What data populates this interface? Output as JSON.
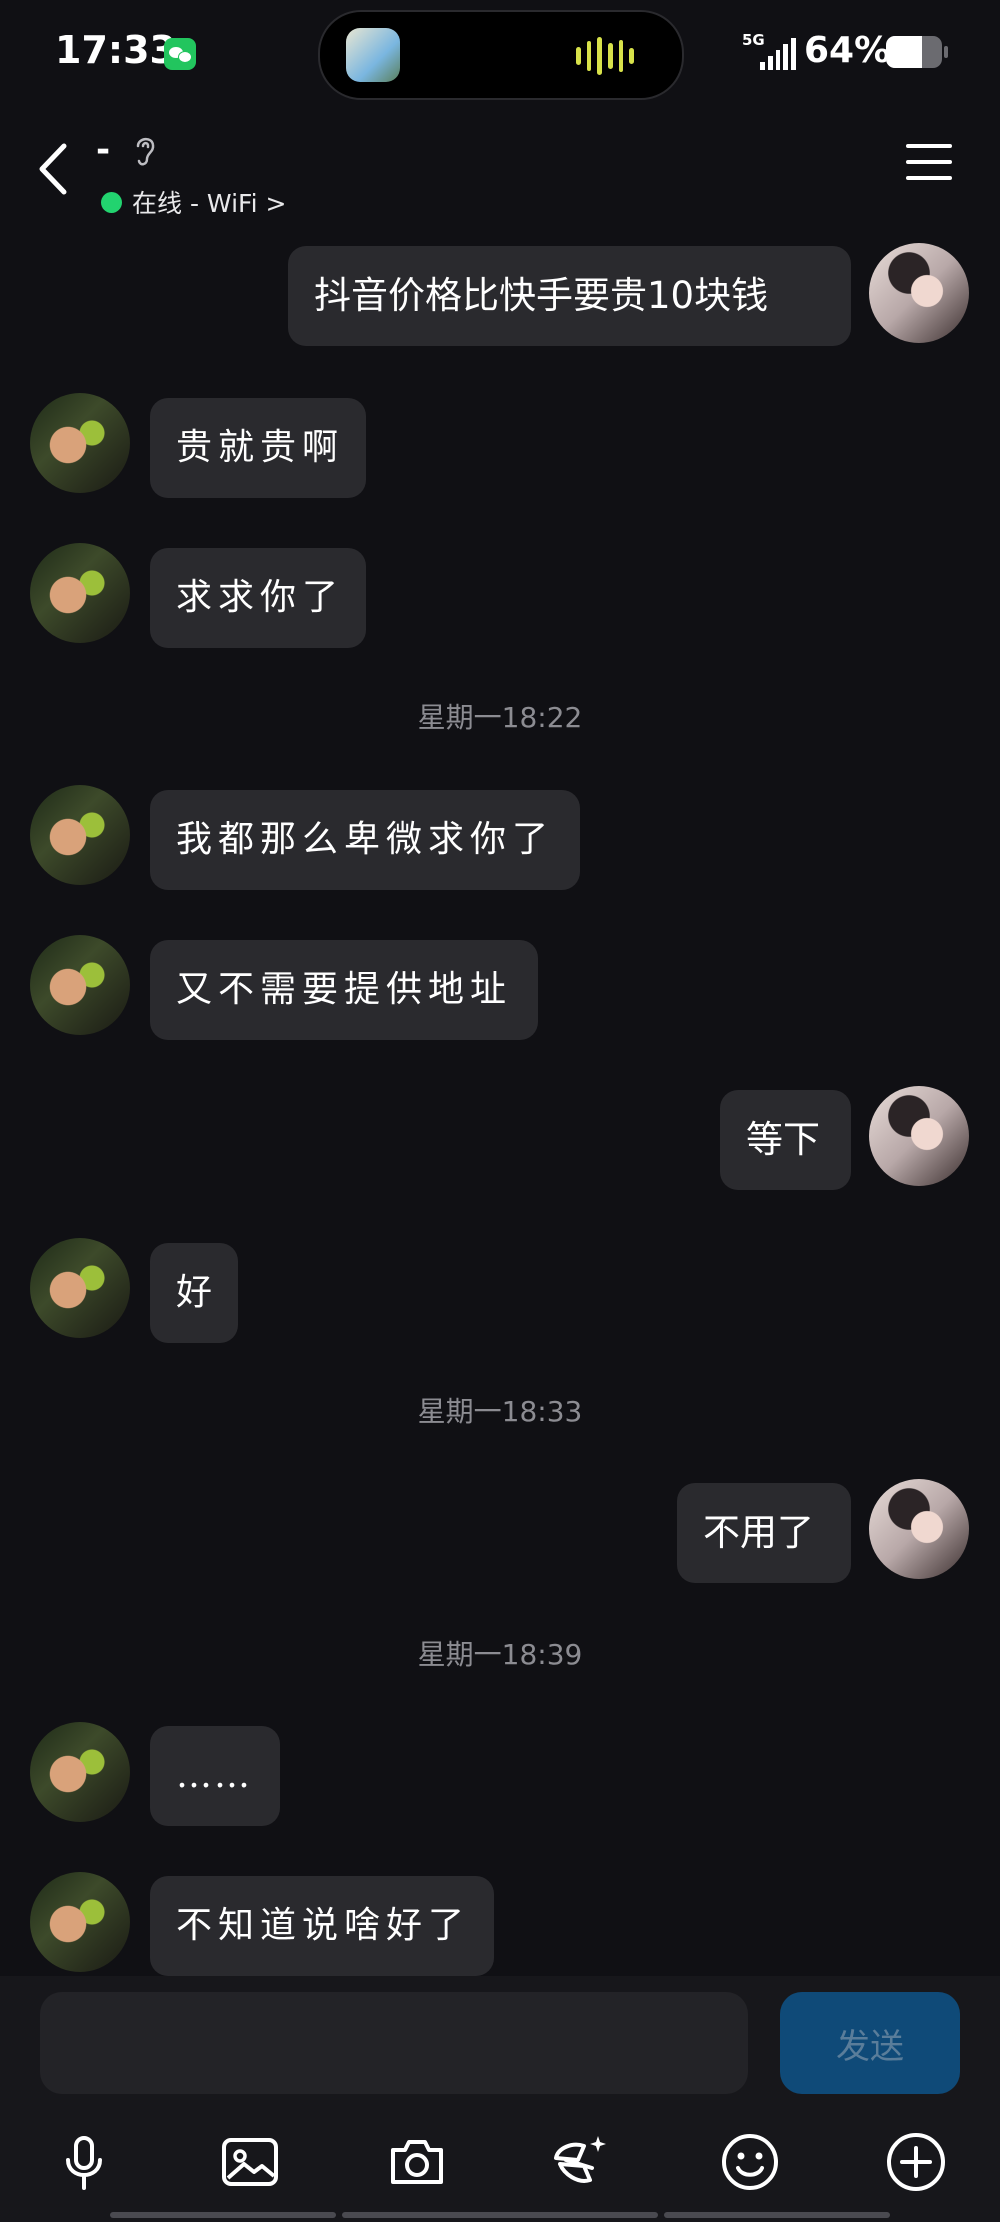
{
  "status_bar": {
    "time": "17:33",
    "network": "5G",
    "battery_percent_text": "64%",
    "battery_level": 0.64
  },
  "header": {
    "contact_name": "-",
    "online_status": "在线 - WiFi >"
  },
  "messages": [
    {
      "side": "right",
      "text": "抖音价格比快手要贵10块钱"
    },
    {
      "side": "left",
      "text": "贵就贵啊"
    },
    {
      "side": "left",
      "text": "求求你了"
    },
    {
      "type": "time",
      "text": "星期一18:22"
    },
    {
      "side": "left",
      "text": "我都那么卑微求你了"
    },
    {
      "side": "left",
      "text": "又不需要提供地址"
    },
    {
      "side": "right",
      "text": "等下"
    },
    {
      "side": "left",
      "text": "好"
    },
    {
      "type": "time",
      "text": "星期一18:33"
    },
    {
      "side": "right",
      "text": "不用了"
    },
    {
      "type": "time",
      "text": "星期一18:39"
    },
    {
      "side": "left",
      "text": "……"
    },
    {
      "side": "left",
      "text": "不知道说啥好了"
    }
  ],
  "input": {
    "value": "",
    "send_label": "发送"
  },
  "toolbar": [
    "microphone-icon",
    "image-icon",
    "camera-icon",
    "magic-pen-icon",
    "emoji-icon",
    "plus-icon"
  ],
  "colors": {
    "background": "#101014",
    "bubble": "#2a2a2e",
    "online": "#22d36f",
    "send_button": "#0f4a78"
  }
}
